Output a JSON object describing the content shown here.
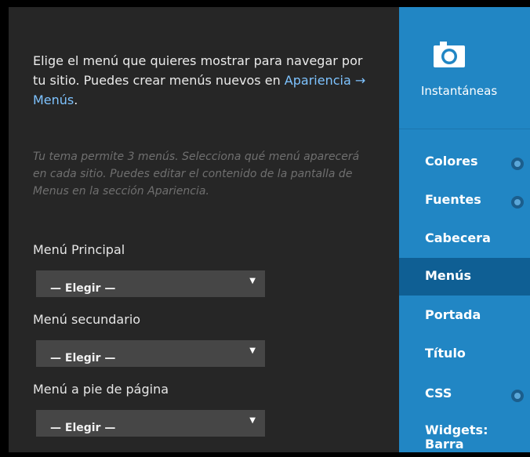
{
  "menus_panel": {
    "intro_text": "Elige el menú que quieres mostrar para navegar por tu sitio. Puedes crear menús nuevos en ",
    "intro_link": "Apariencia → Menús",
    "intro_end": ".",
    "hint": "Tu tema permite 3 menús. Selecciona qué menú aparecerá en cada sitio. Puedes editar el contenido de la pantalla de Menus en la sección Apariencia.",
    "fields": [
      {
        "label": "Menú Principal",
        "selected": "— Elegir —"
      },
      {
        "label": "Menú secundario",
        "selected": "— Elegir —"
      },
      {
        "label": "Menú a pie de página",
        "selected": "— Elegir —"
      }
    ]
  },
  "sidebar": {
    "snapshots_label": "Instantáneas",
    "snapshots_icon": "camera-icon",
    "items": [
      {
        "label": "Colores",
        "has_dot": true
      },
      {
        "label": "Fuentes",
        "has_dot": true
      },
      {
        "label": "Cabecera",
        "has_dot": false
      },
      {
        "label": "Menús",
        "has_dot": false,
        "active": true
      },
      {
        "label": "Portada",
        "has_dot": false
      },
      {
        "label": "Título",
        "has_dot": false
      },
      {
        "label": "CSS",
        "has_dot": true
      },
      {
        "label": "Widgets: Barra",
        "has_dot": false
      }
    ]
  },
  "colors": {
    "panel_bg": "#262626",
    "sidebar_bg": "#2186c4",
    "sidebar_active_bg": "#0f5f94",
    "link": "#7ec3ff"
  }
}
